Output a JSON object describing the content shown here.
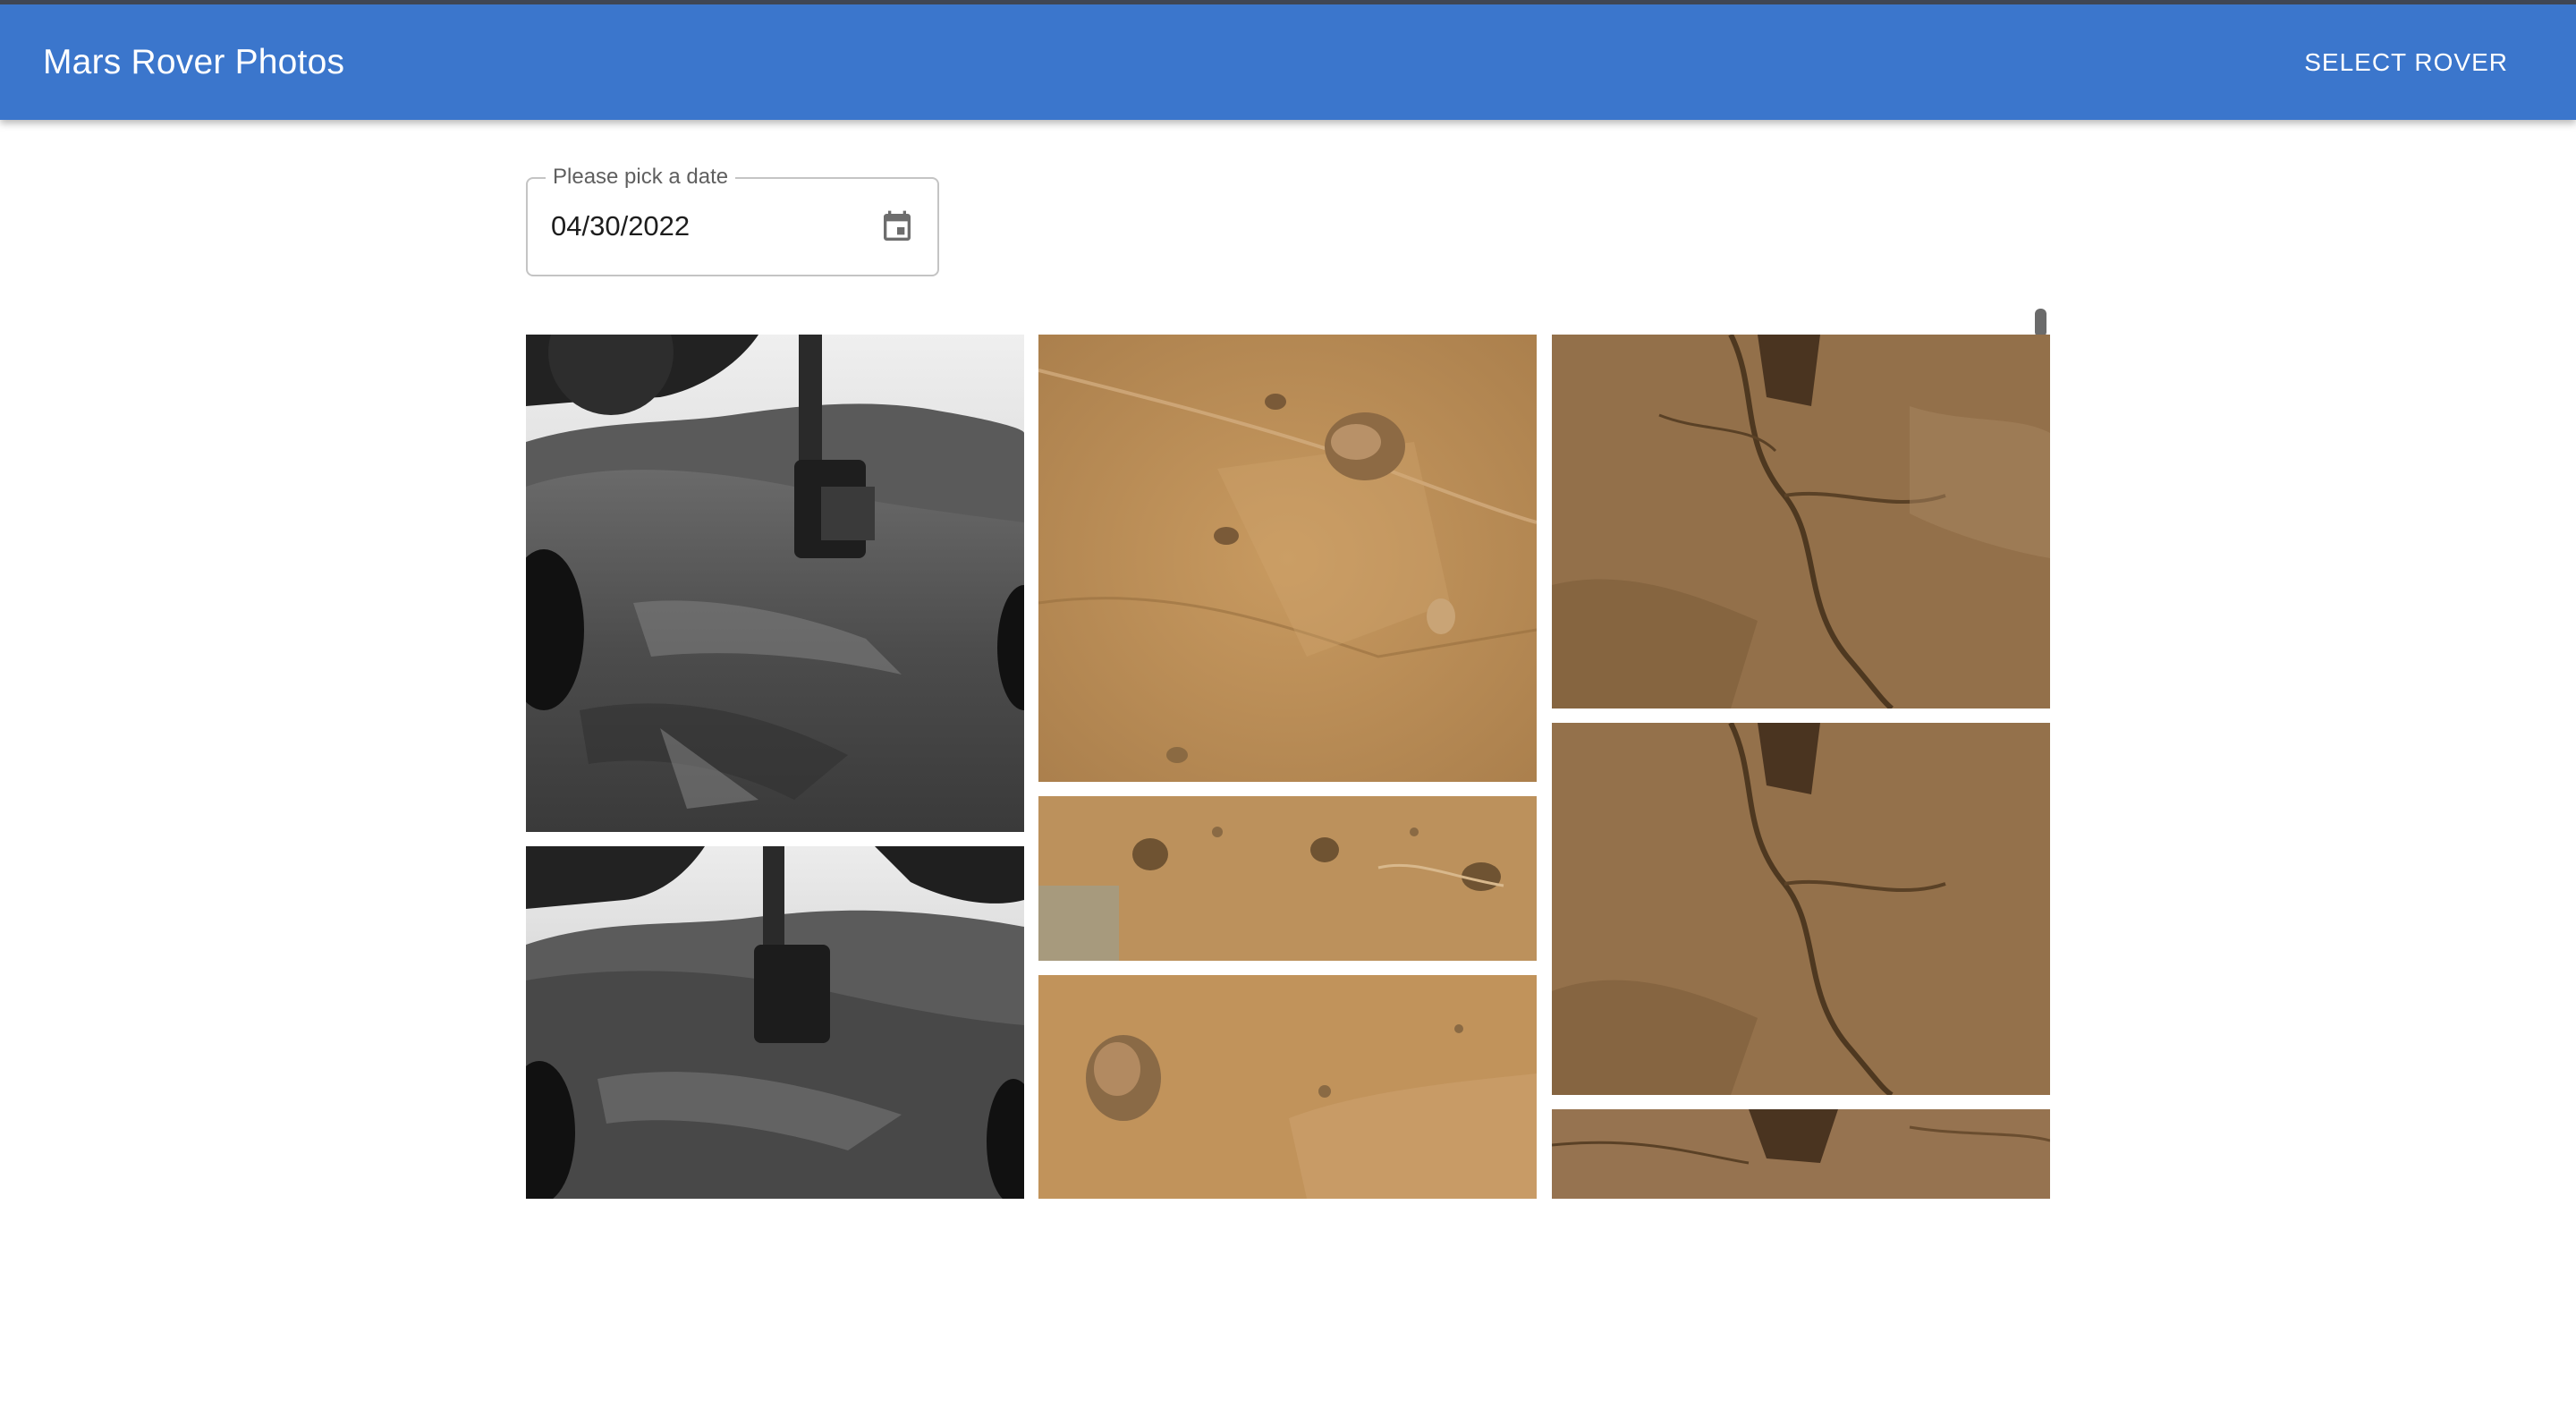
{
  "app": {
    "title": "Mars Rover Photos",
    "select_rover_label": "SELECT ROVER",
    "bar_color": "#3b76cc"
  },
  "date_picker": {
    "label": "Please pick a date",
    "value": "04/30/2022",
    "icon": "calendar-icon"
  },
  "gallery": {
    "photos": [
      {
        "name": "grayscale-arm-photo",
        "tone": "grayscale"
      },
      {
        "name": "grayscale-arm-photo",
        "tone": "grayscale"
      },
      {
        "name": "mars-rock-surface-photo",
        "tone": "tan"
      },
      {
        "name": "mars-rock-surface-photo",
        "tone": "tan"
      },
      {
        "name": "mars-rock-surface-photo",
        "tone": "tan"
      },
      {
        "name": "mars-rock-closeup-photo",
        "tone": "brown"
      },
      {
        "name": "mars-rock-closeup-photo",
        "tone": "brown"
      },
      {
        "name": "mars-rock-closeup-photo",
        "tone": "brown"
      }
    ]
  }
}
